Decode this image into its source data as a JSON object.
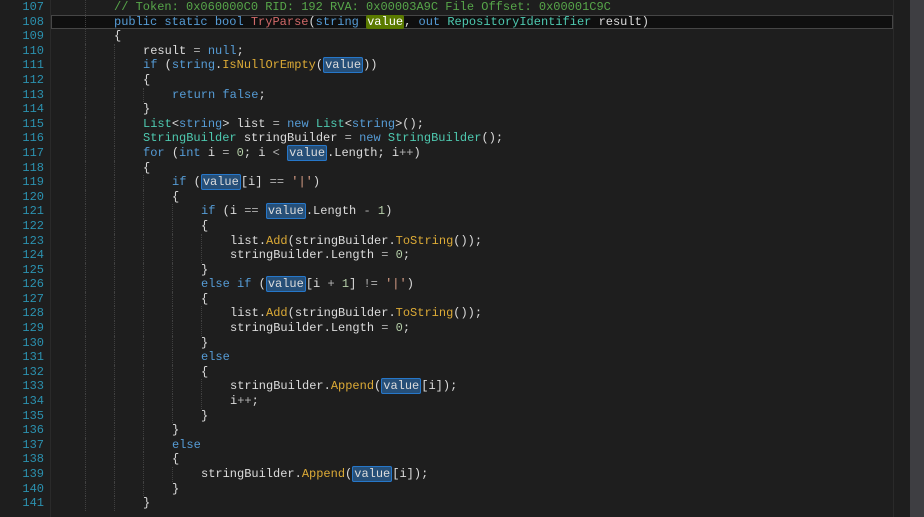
{
  "file": {
    "language": "C#"
  },
  "selection": {
    "word": "value",
    "occurrences_style": "highlight-blue",
    "primary_style": "highlight-green"
  },
  "gutter": {
    "start": 107,
    "end": 141
  },
  "tokens": {
    "kw_public": "public",
    "kw_static": "static",
    "kw_bool": "bool",
    "kw_string": "string",
    "kw_out": "out",
    "kw_if": "if",
    "kw_else": "else",
    "kw_elseif": "else if",
    "kw_for": "for",
    "kw_int": "int",
    "kw_null": "null",
    "kw_false": "false",
    "kw_return": "return",
    "kw_new": "new",
    "type_list": "List",
    "type_sb": "StringBuilder",
    "type_repoid": "RepositoryIdentifier",
    "id_value": "value",
    "id_result": "result",
    "id_list": "list",
    "id_sb": "stringBuilder",
    "id_i": "i",
    "prop_length": "Length",
    "meth_tryparse": "TryParse",
    "meth_isnull": "IsNullOrEmpty",
    "meth_add": "Add",
    "meth_tostr": "ToString",
    "meth_append": "Append",
    "num_0": "0",
    "num_1": "1",
    "str_pipe": "'|'",
    "cmt_token": "// Token: 0x060000C0 RID: 192 RVA: 0x00003A9C File Offset: 0x00001C9C"
  }
}
